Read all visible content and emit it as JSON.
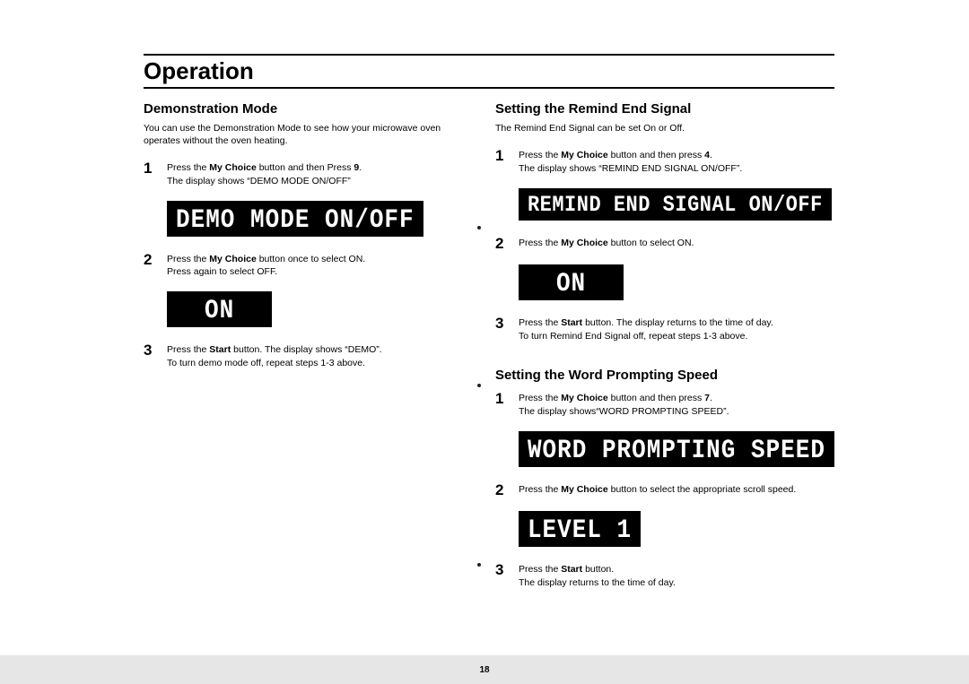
{
  "header": {
    "title": "Operation"
  },
  "left": {
    "h": "Demonstration Mode",
    "intro": "You can use the Demonstration Mode to see how your microwave oven operates without the oven heating.",
    "s1a": "Press the ",
    "s1b": " button and then Press ",
    "s1c": ".",
    "s1d": "The display shows  “DEMO MODE ON/OFF”",
    "disp1": "DEMO MODE ON/OFF",
    "s2a": "Press the ",
    "s2b": " button once to select ON.",
    "s2c": "Press again to select OFF.",
    "disp2": "ON",
    "s3a": "Press the ",
    "s3b": " button. The display shows “DEMO”.",
    "s3c": "To turn demo mode off, repeat steps 1-3 above.",
    "bold_mychoice": "My Choice",
    "bold_9": "9",
    "bold_start": "Start"
  },
  "right": {
    "sec1": {
      "h": "Setting the Remind End Signal",
      "intro": "The Remind End Signal can be set On or Off.",
      "s1a": "Press the ",
      "s1b": " button and then press ",
      "s1c": ".",
      "s1d": "The display shows “REMIND END SIGNAL ON/OFF”.",
      "disp1": "REMIND END SIGNAL ON/OFF",
      "s2a": "Press the ",
      "s2b": " button to select ON.",
      "disp2": "ON",
      "s3a": "Press the ",
      "s3b": " button. The display returns to the time of day.",
      "s3c": "To turn Remind End Signal off, repeat steps 1-3 above.",
      "bold_4": "4"
    },
    "sec2": {
      "h": "Setting the Word Prompting Speed",
      "s1a": "Press the ",
      "s1b": " button and then press ",
      "s1c": ".",
      "s1d": "The display shows“WORD PROMPTING SPEED”.",
      "disp1": "WORD PROMPTING SPEED",
      "s2a": "Press the ",
      "s2b": " button to select the appropriate scroll speed.",
      "disp2": "LEVEL 1",
      "s3a": "Press the ",
      "s3b": " button.",
      "s3c": "The display returns to the time of day.",
      "bold_7": "7"
    }
  },
  "footer": {
    "page": "18"
  }
}
